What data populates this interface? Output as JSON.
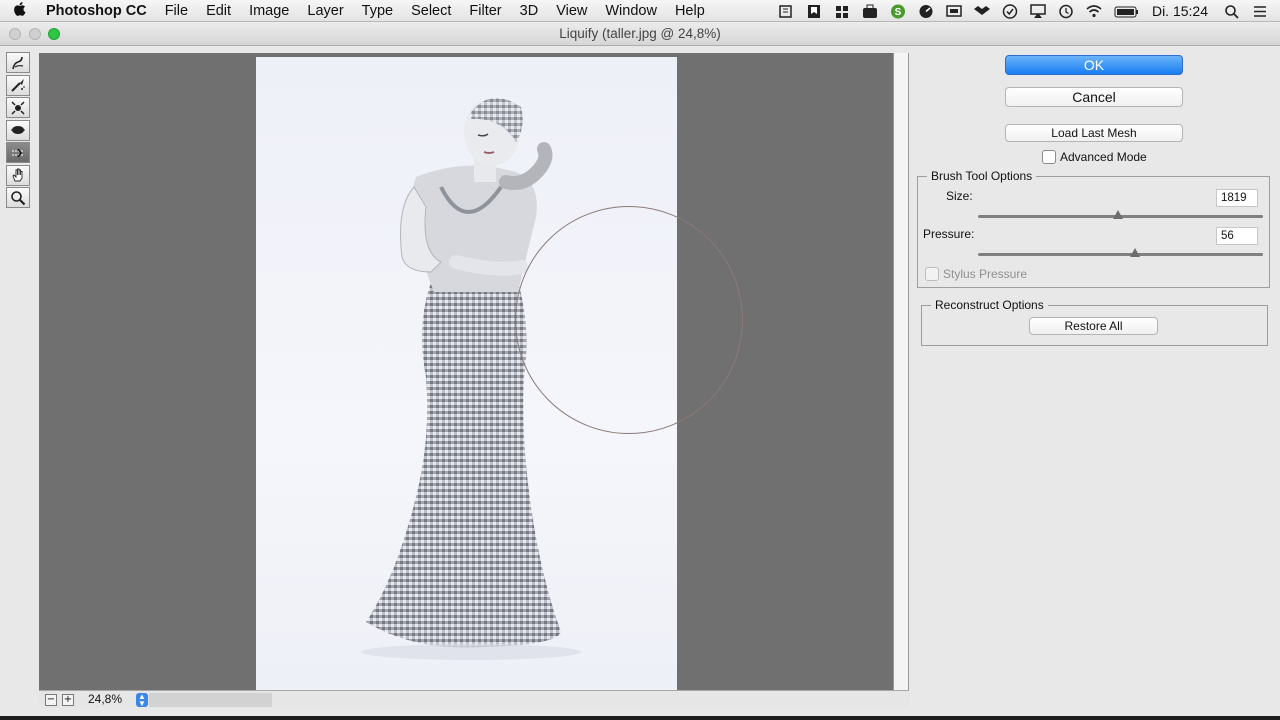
{
  "menubar": {
    "app_name": "Photoshop CC",
    "menus": [
      "File",
      "Edit",
      "Image",
      "Layer",
      "Type",
      "Select",
      "Filter",
      "3D",
      "View",
      "Window",
      "Help"
    ],
    "clock": "Di. 15:24",
    "status_icons": [
      "evernote-icon",
      "bookmark-icon",
      "grid-icon",
      "suitcase-icon",
      "skype-icon",
      "dial-icon",
      "screen-icon",
      "dropbox-icon",
      "check-icon",
      "airplay-icon",
      "time-machine-icon",
      "wifi-icon",
      "battery-icon",
      "spotlight-icon",
      "list-icon"
    ]
  },
  "window": {
    "title": "Liquify (taller.jpg @ 24,8%)"
  },
  "tools": [
    {
      "name": "forward-warp-tool",
      "icon": "warp-icon",
      "active": false
    },
    {
      "name": "reconstruct-tool",
      "icon": "reconstruct-icon",
      "active": false
    },
    {
      "name": "pucker-tool",
      "icon": "pucker-icon",
      "active": false
    },
    {
      "name": "bloat-tool",
      "icon": "bloat-icon",
      "active": false
    },
    {
      "name": "push-left-tool",
      "icon": "push-left-icon",
      "active": true
    },
    {
      "name": "hand-tool",
      "icon": "hand-icon",
      "active": false
    },
    {
      "name": "zoom-tool",
      "icon": "magnifier-icon",
      "active": false
    }
  ],
  "statusbar": {
    "zoom_out": "−",
    "zoom_in": "+",
    "zoom_value": "24,8%"
  },
  "panel": {
    "ok_label": "OK",
    "cancel_label": "Cancel",
    "load_last_mesh_label": "Load Last Mesh",
    "advanced_mode_label": "Advanced Mode",
    "advanced_mode_checked": false,
    "brush_group": {
      "title": "Brush Tool Options",
      "size_label": "Size:",
      "size_value": "1819",
      "size_fraction": 0.49,
      "pressure_label": "Pressure:",
      "pressure_value": "56",
      "pressure_fraction": 0.55,
      "stylus_label": "Stylus Pressure",
      "stylus_checked": false
    },
    "reconstruct_group": {
      "title": "Reconstruct Options",
      "restore_all_label": "Restore All"
    }
  },
  "colors": {
    "accent": "#1a7ef2",
    "canvas_bg": "#707070",
    "brush_circle": "#8a7a76"
  }
}
